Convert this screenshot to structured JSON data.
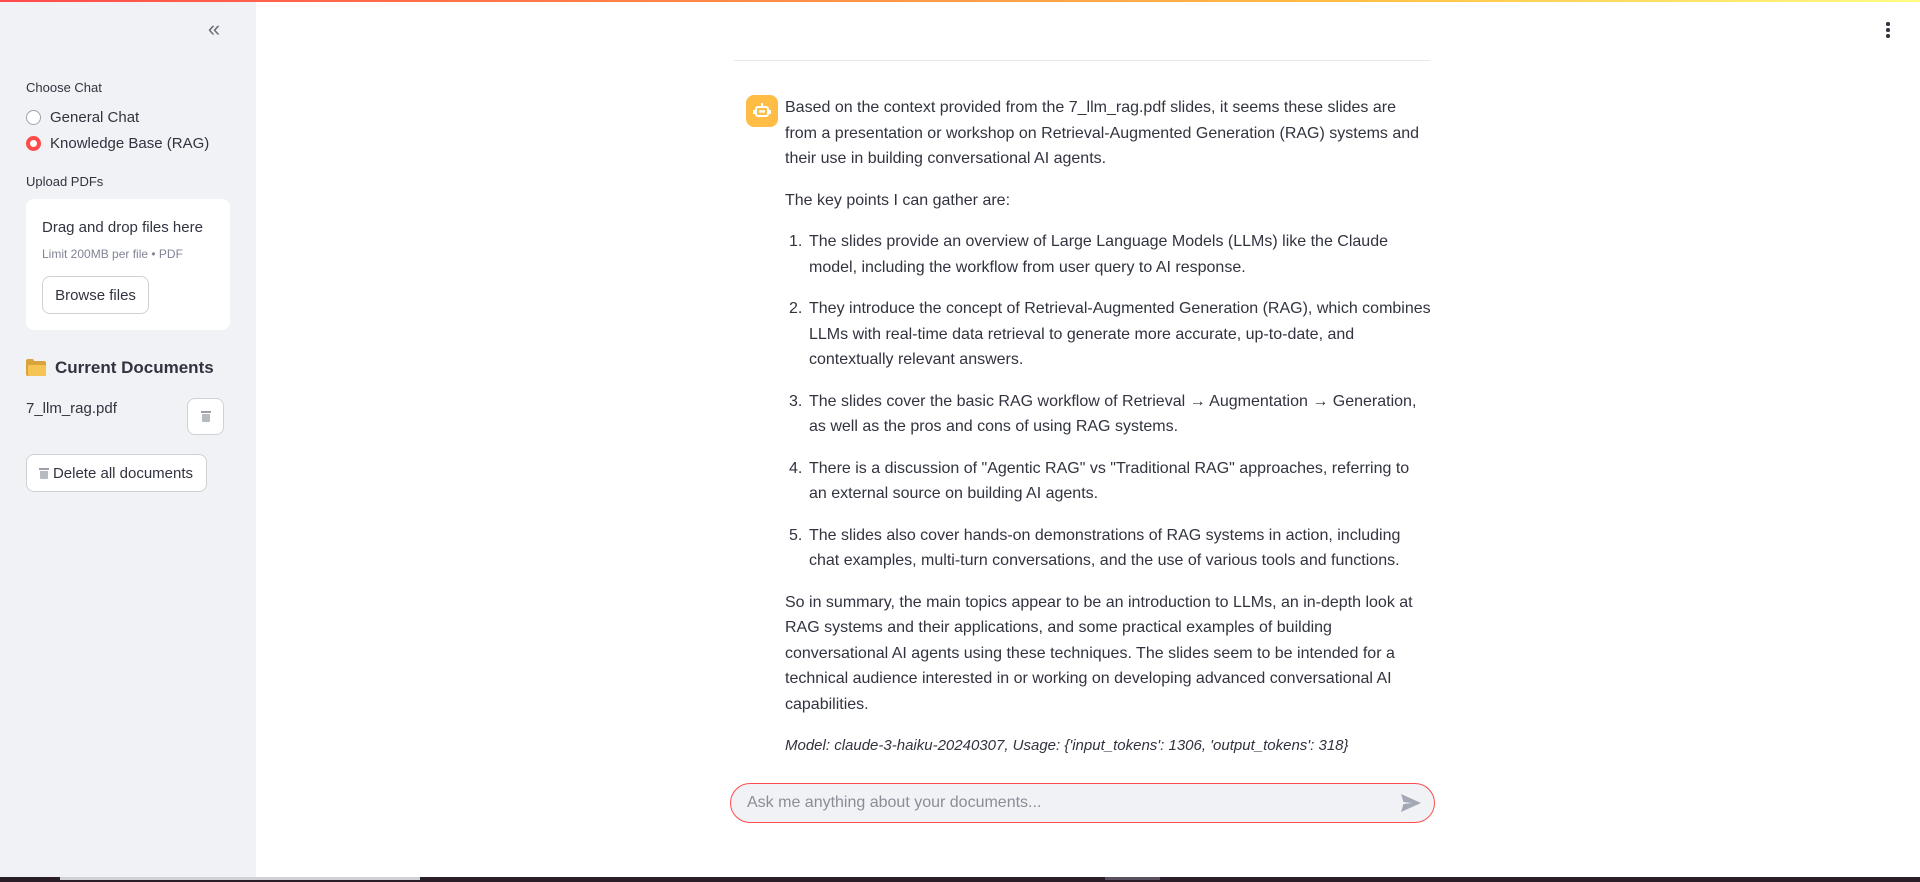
{
  "sidebar": {
    "collapse_icon": "double-chevron-left-icon",
    "choose_chat_label": "Choose Chat",
    "chat_options": [
      {
        "label": "General Chat",
        "selected": false
      },
      {
        "label": "Knowledge Base (RAG)",
        "selected": true
      }
    ],
    "upload_label": "Upload PDFs",
    "upload": {
      "title": "Drag and drop files here",
      "limit": "Limit 200MB per file • PDF",
      "browse_label": "Browse files"
    },
    "documents_header": "Current Documents",
    "documents": [
      {
        "name": "7_llm_rag.pdf"
      }
    ],
    "delete_all_label": "Delete all documents"
  },
  "message": {
    "intro": "Based on the context provided from the 7_llm_rag.pdf slides, it seems these slides are from a presentation or workshop on Retrieval-Augmented Generation (RAG) systems and their use in building conversational AI agents.",
    "key_points_intro": "The key points I can gather are:",
    "points": [
      {
        "num": "1.",
        "text": "The slides provide an overview of Large Language Models (LLMs) like the Claude model, including the workflow from user query to AI response."
      },
      {
        "num": "2.",
        "text": "They introduce the concept of Retrieval-Augmented Generation (RAG), which combines LLMs with real-time data retrieval to generate more accurate, up-to-date, and contextually relevant answers."
      },
      {
        "num": "3.",
        "text": "The slides cover the basic RAG workflow of Retrieval → Augmentation → Generation, as well as the pros and cons of using RAG systems."
      },
      {
        "num": "4.",
        "text": "There is a discussion of \"Agentic RAG\" vs \"Traditional RAG\" approaches, referring to an external source on building AI agents."
      },
      {
        "num": "5.",
        "text": "The slides also cover hands-on demonstrations of RAG systems in action, including chat examples, multi-turn conversations, and the use of various tools and functions."
      }
    ],
    "summary": "So in summary, the main topics appear to be an introduction to LLMs, an in-depth look at RAG systems and their applications, and some practical examples of building conversational AI agents using these techniques. The slides seem to be intended for a technical audience interested in or working on developing advanced conversational AI capabilities.",
    "model_info": "Model: claude-3-haiku-20240307, Usage: {'input_tokens': 1306, 'output_tokens': 318}"
  },
  "chat_input": {
    "value": "",
    "placeholder": "Ask me anything about your documents..."
  },
  "colors": {
    "accent": "#ff4b4b",
    "avatar": "#ffbd45",
    "sidebar_bg": "#f0f2f6"
  }
}
